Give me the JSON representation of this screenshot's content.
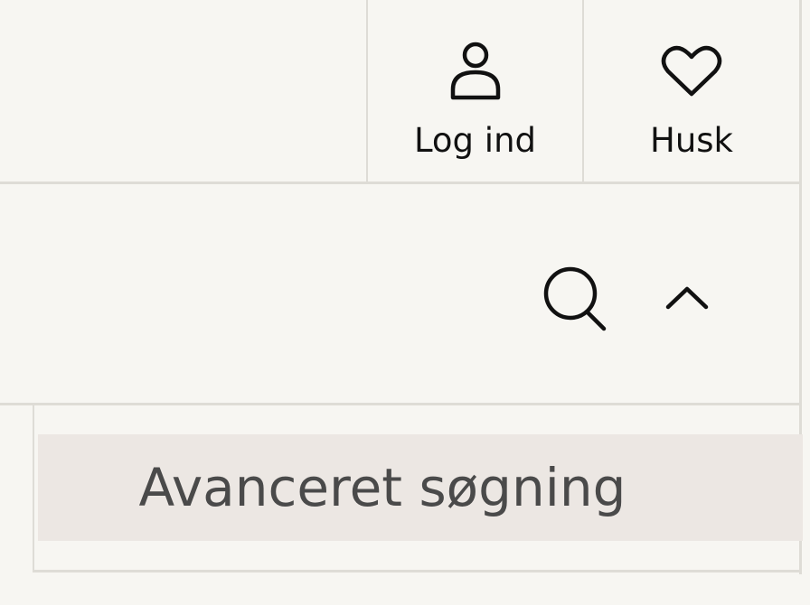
{
  "header": {
    "login": {
      "label": "Log ind",
      "icon": "user-icon"
    },
    "favorites": {
      "label": "Husk",
      "icon": "heart-icon"
    }
  },
  "search_bar": {
    "search_icon": "search-icon",
    "collapse_icon": "chevron-up-icon"
  },
  "advanced_search": {
    "label": "Avanceret søgning",
    "background": "#ece7e3"
  },
  "colors": {
    "page_background": "#f7f6f2",
    "divider": "#dedcd6",
    "text": "#111111"
  }
}
